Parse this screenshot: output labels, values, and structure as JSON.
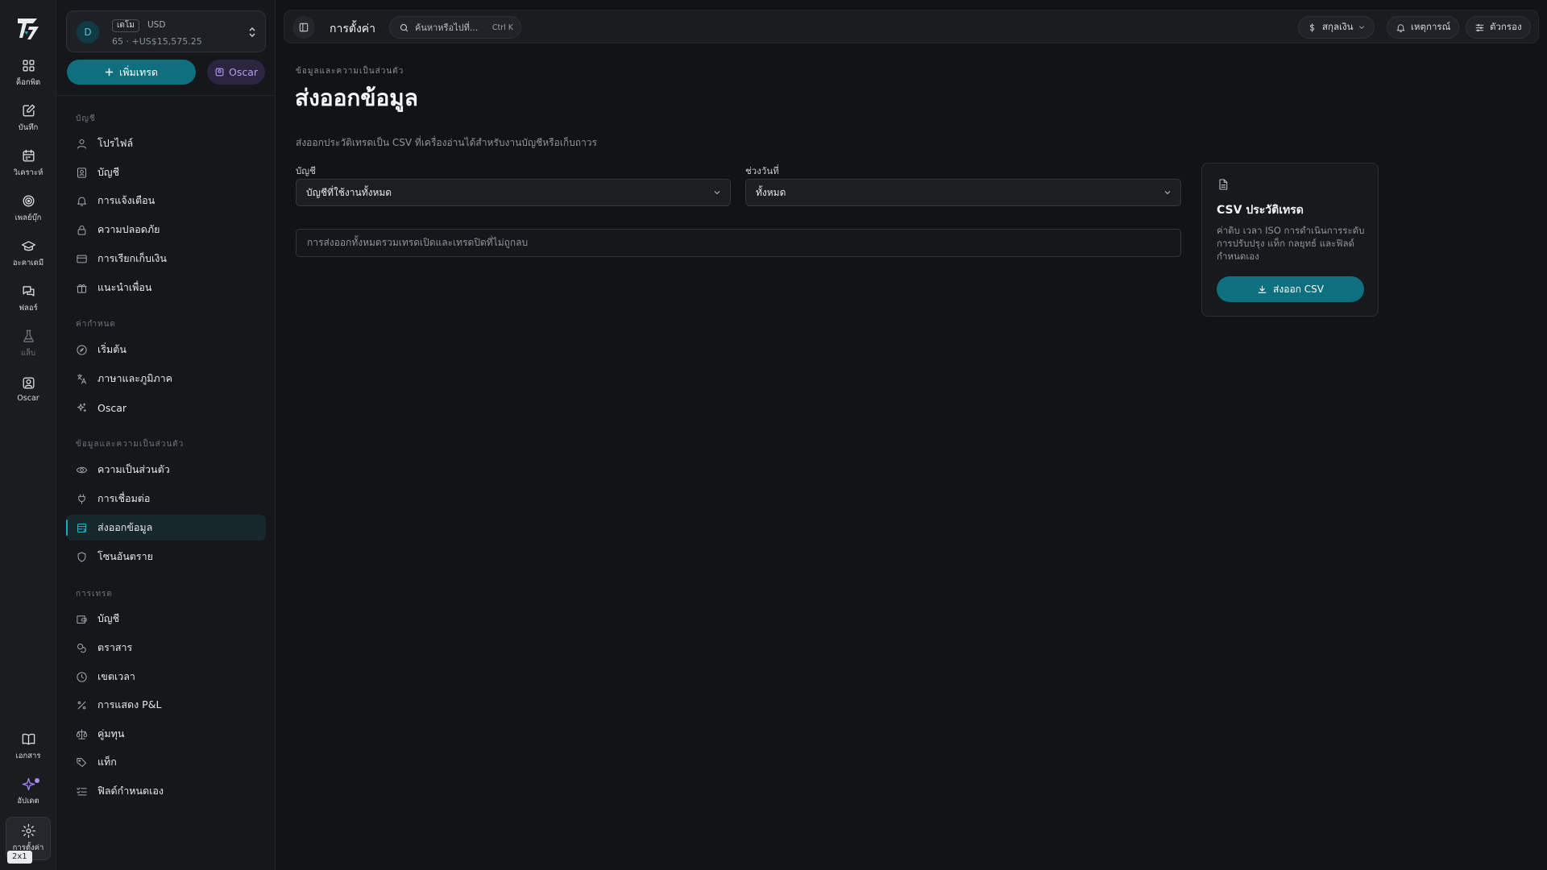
{
  "rail": {
    "items": [
      {
        "label": "ค็อกพิต",
        "icon": "grid-icon"
      },
      {
        "label": "บันทึก",
        "icon": "notebook-icon"
      },
      {
        "label": "วิเคราะห์",
        "icon": "calendar-icon"
      },
      {
        "label": "เพลย์บุ๊ก",
        "icon": "target-icon"
      },
      {
        "label": "อะคาเดมี",
        "icon": "graduation-cap-icon"
      },
      {
        "label": "ฟลอร์",
        "icon": "chat-icon"
      },
      {
        "label": "แล็บ",
        "icon": "flask-icon"
      },
      {
        "label": "Oscar",
        "icon": "oscar-icon"
      }
    ],
    "bottom": [
      {
        "label": "เอกสาร",
        "icon": "book-icon"
      },
      {
        "label": "อัปเดต",
        "icon": "sparkle-icon"
      },
      {
        "label": "การตั้งค่า",
        "icon": "gear-icon"
      }
    ],
    "size_badge": "2x1"
  },
  "account": {
    "avatar": "D",
    "tag": "เดโม",
    "currency": "USD",
    "summary": "65 · +US$15,575.25"
  },
  "sidebar": {
    "add_trade": "เพิ่มเทรด",
    "oscar": "Oscar",
    "sections": [
      {
        "heading": "บัญชี",
        "items": [
          {
            "label": "โปรไฟล์",
            "icon": "user-icon"
          },
          {
            "label": "บัญชี",
            "icon": "id-card-icon"
          },
          {
            "label": "การแจ้งเตือน",
            "icon": "bell-icon"
          },
          {
            "label": "ความปลอดภัย",
            "icon": "lock-icon"
          },
          {
            "label": "การเรียกเก็บเงิน",
            "icon": "credit-card-icon"
          },
          {
            "label": "แนะนำเพื่อน",
            "icon": "gift-icon"
          }
        ]
      },
      {
        "heading": "ค่ากำหนด",
        "items": [
          {
            "label": "เริ่มต้น",
            "icon": "compass-icon"
          },
          {
            "label": "ภาษาและภูมิภาค",
            "icon": "translate-icon"
          },
          {
            "label": "Oscar",
            "icon": "sparkles-icon"
          }
        ]
      },
      {
        "heading": "ข้อมูลและความเป็นส่วนตัว",
        "items": [
          {
            "label": "ความเป็นส่วนตัว",
            "icon": "eye-icon"
          },
          {
            "label": "การเชื่อมต่อ",
            "icon": "plug-icon"
          },
          {
            "label": "ส่งออกข้อมูล",
            "icon": "database-export-icon"
          },
          {
            "label": "โซนอันตราย",
            "icon": "shield-icon"
          }
        ]
      },
      {
        "heading": "การเทรด",
        "items": [
          {
            "label": "บัญชี",
            "icon": "wallet-icon"
          },
          {
            "label": "ตราสาร",
            "icon": "coins-icon"
          },
          {
            "label": "เขตเวลา",
            "icon": "clock-icon"
          },
          {
            "label": "การแสดง P&L",
            "icon": "percent-icon"
          },
          {
            "label": "คู่มทุน",
            "icon": "scale-icon"
          },
          {
            "label": "แท็ก",
            "icon": "tag-icon"
          },
          {
            "label": "ฟิลด์กำหนดเอง",
            "icon": "list-check-icon"
          }
        ]
      }
    ],
    "active": "ส่งออกข้อมูล"
  },
  "topbar": {
    "title": "การตั้งค่า",
    "search_placeholder": "ค้นหาหรือไปที่...",
    "search_shortcut": "Ctrl K",
    "currency_btn": "สกุลเงิน",
    "events_btn": "เหตุการณ์",
    "filter_btn": "ตัวกรอง"
  },
  "main": {
    "breadcrumb": "ข้อมูลและความเป็นส่วนตัว",
    "title": "ส่งออกข้อมูล",
    "description": "ส่งออกประวัติเทรดเป็น CSV ที่เครื่องอ่านได้สำหรับงานบัญชีหรือเก็บถาวร",
    "account_label": "บัญชี",
    "account_value": "บัญชีที่ใช้งานทั้งหมด",
    "range_label": "ช่วงวันที่",
    "range_value": "ทั้งหมด",
    "note": "การส่งออกทั้งหมดรวมเทรดเปิดและเทรดปิดที่ไม่ถูกลบ"
  },
  "card": {
    "title": "CSV ประวัติเทรด",
    "description": "ค่าดิบ เวลา ISO การดำเนินการระดับ การปรับปรุง แท็ก กลยุทธ์ และฟิลด์กำหนดเอง",
    "button": "ส่งออก CSV"
  },
  "colors": {
    "accent": "#0e6f7e",
    "accent_text": "#2fb2c8",
    "oscar": "#b69cf7"
  }
}
